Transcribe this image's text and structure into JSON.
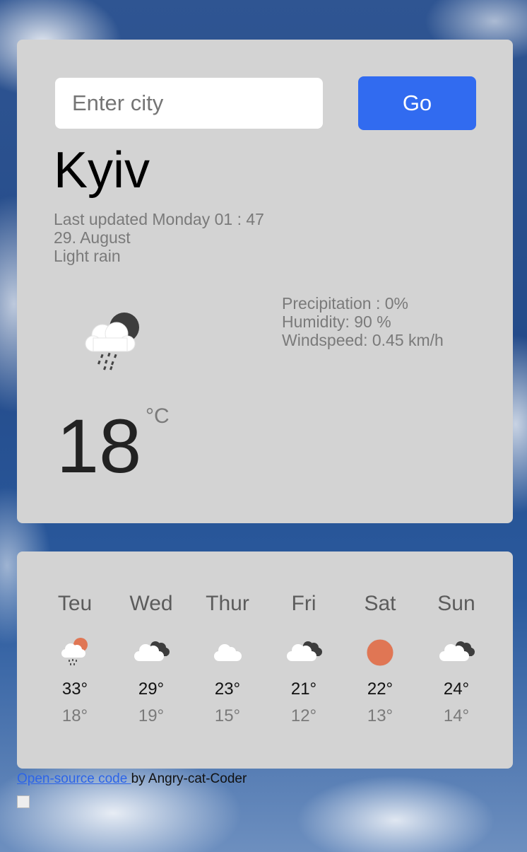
{
  "search": {
    "placeholder": "Enter city",
    "value": ""
  },
  "go_label": "Go",
  "current": {
    "city": "Kyiv",
    "last_updated": "Last updated Monday 01 : 47",
    "date": "29. August",
    "description": "Light rain",
    "precipitation": "Precipitation : 0%",
    "humidity": "Humidity: 90 %",
    "windspeed": "Windspeed: 0.45 km/h",
    "temperature": "18",
    "unit": "°C",
    "icon": "rain-moon-icon"
  },
  "forecast": [
    {
      "day": "Teu",
      "high": "33°",
      "low": "18°",
      "icon": "rain-sun-icon"
    },
    {
      "day": "Wed",
      "high": "29°",
      "low": "19°",
      "icon": "cloudy-icon"
    },
    {
      "day": "Thur",
      "high": "23°",
      "low": "15°",
      "icon": "cloud-icon"
    },
    {
      "day": "Fri",
      "high": "21°",
      "low": "12°",
      "icon": "cloudy-icon"
    },
    {
      "day": "Sat",
      "high": "22°",
      "low": "13°",
      "icon": "sun-icon"
    },
    {
      "day": "Sun",
      "high": "24°",
      "low": "14°",
      "icon": "cloudy-icon"
    }
  ],
  "footer": {
    "link_text": "Open-source code ",
    "suffix": "by Angry-cat-Coder"
  },
  "colors": {
    "accent": "#316bf0",
    "card": "#d3d3d3",
    "sun": "#e07654"
  }
}
